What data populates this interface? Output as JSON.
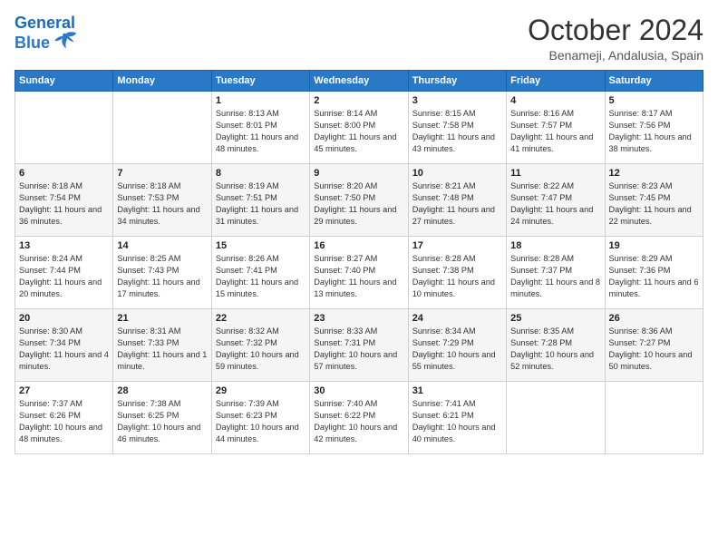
{
  "header": {
    "logo_line1": "General",
    "logo_line2": "Blue",
    "month_title": "October 2024",
    "subtitle": "Benameji, Andalusia, Spain"
  },
  "weekdays": [
    "Sunday",
    "Monday",
    "Tuesday",
    "Wednesday",
    "Thursday",
    "Friday",
    "Saturday"
  ],
  "weeks": [
    [
      {
        "day": "",
        "info": ""
      },
      {
        "day": "",
        "info": ""
      },
      {
        "day": "1",
        "info": "Sunrise: 8:13 AM\nSunset: 8:01 PM\nDaylight: 11 hours and 48 minutes."
      },
      {
        "day": "2",
        "info": "Sunrise: 8:14 AM\nSunset: 8:00 PM\nDaylight: 11 hours and 45 minutes."
      },
      {
        "day": "3",
        "info": "Sunrise: 8:15 AM\nSunset: 7:58 PM\nDaylight: 11 hours and 43 minutes."
      },
      {
        "day": "4",
        "info": "Sunrise: 8:16 AM\nSunset: 7:57 PM\nDaylight: 11 hours and 41 minutes."
      },
      {
        "day": "5",
        "info": "Sunrise: 8:17 AM\nSunset: 7:56 PM\nDaylight: 11 hours and 38 minutes."
      }
    ],
    [
      {
        "day": "6",
        "info": "Sunrise: 8:18 AM\nSunset: 7:54 PM\nDaylight: 11 hours and 36 minutes."
      },
      {
        "day": "7",
        "info": "Sunrise: 8:18 AM\nSunset: 7:53 PM\nDaylight: 11 hours and 34 minutes."
      },
      {
        "day": "8",
        "info": "Sunrise: 8:19 AM\nSunset: 7:51 PM\nDaylight: 11 hours and 31 minutes."
      },
      {
        "day": "9",
        "info": "Sunrise: 8:20 AM\nSunset: 7:50 PM\nDaylight: 11 hours and 29 minutes."
      },
      {
        "day": "10",
        "info": "Sunrise: 8:21 AM\nSunset: 7:48 PM\nDaylight: 11 hours and 27 minutes."
      },
      {
        "day": "11",
        "info": "Sunrise: 8:22 AM\nSunset: 7:47 PM\nDaylight: 11 hours and 24 minutes."
      },
      {
        "day": "12",
        "info": "Sunrise: 8:23 AM\nSunset: 7:45 PM\nDaylight: 11 hours and 22 minutes."
      }
    ],
    [
      {
        "day": "13",
        "info": "Sunrise: 8:24 AM\nSunset: 7:44 PM\nDaylight: 11 hours and 20 minutes."
      },
      {
        "day": "14",
        "info": "Sunrise: 8:25 AM\nSunset: 7:43 PM\nDaylight: 11 hours and 17 minutes."
      },
      {
        "day": "15",
        "info": "Sunrise: 8:26 AM\nSunset: 7:41 PM\nDaylight: 11 hours and 15 minutes."
      },
      {
        "day": "16",
        "info": "Sunrise: 8:27 AM\nSunset: 7:40 PM\nDaylight: 11 hours and 13 minutes."
      },
      {
        "day": "17",
        "info": "Sunrise: 8:28 AM\nSunset: 7:38 PM\nDaylight: 11 hours and 10 minutes."
      },
      {
        "day": "18",
        "info": "Sunrise: 8:28 AM\nSunset: 7:37 PM\nDaylight: 11 hours and 8 minutes."
      },
      {
        "day": "19",
        "info": "Sunrise: 8:29 AM\nSunset: 7:36 PM\nDaylight: 11 hours and 6 minutes."
      }
    ],
    [
      {
        "day": "20",
        "info": "Sunrise: 8:30 AM\nSunset: 7:34 PM\nDaylight: 11 hours and 4 minutes."
      },
      {
        "day": "21",
        "info": "Sunrise: 8:31 AM\nSunset: 7:33 PM\nDaylight: 11 hours and 1 minute."
      },
      {
        "day": "22",
        "info": "Sunrise: 8:32 AM\nSunset: 7:32 PM\nDaylight: 10 hours and 59 minutes."
      },
      {
        "day": "23",
        "info": "Sunrise: 8:33 AM\nSunset: 7:31 PM\nDaylight: 10 hours and 57 minutes."
      },
      {
        "day": "24",
        "info": "Sunrise: 8:34 AM\nSunset: 7:29 PM\nDaylight: 10 hours and 55 minutes."
      },
      {
        "day": "25",
        "info": "Sunrise: 8:35 AM\nSunset: 7:28 PM\nDaylight: 10 hours and 52 minutes."
      },
      {
        "day": "26",
        "info": "Sunrise: 8:36 AM\nSunset: 7:27 PM\nDaylight: 10 hours and 50 minutes."
      }
    ],
    [
      {
        "day": "27",
        "info": "Sunrise: 7:37 AM\nSunset: 6:26 PM\nDaylight: 10 hours and 48 minutes."
      },
      {
        "day": "28",
        "info": "Sunrise: 7:38 AM\nSunset: 6:25 PM\nDaylight: 10 hours and 46 minutes."
      },
      {
        "day": "29",
        "info": "Sunrise: 7:39 AM\nSunset: 6:23 PM\nDaylight: 10 hours and 44 minutes."
      },
      {
        "day": "30",
        "info": "Sunrise: 7:40 AM\nSunset: 6:22 PM\nDaylight: 10 hours and 42 minutes."
      },
      {
        "day": "31",
        "info": "Sunrise: 7:41 AM\nSunset: 6:21 PM\nDaylight: 10 hours and 40 minutes."
      },
      {
        "day": "",
        "info": ""
      },
      {
        "day": "",
        "info": ""
      }
    ]
  ]
}
